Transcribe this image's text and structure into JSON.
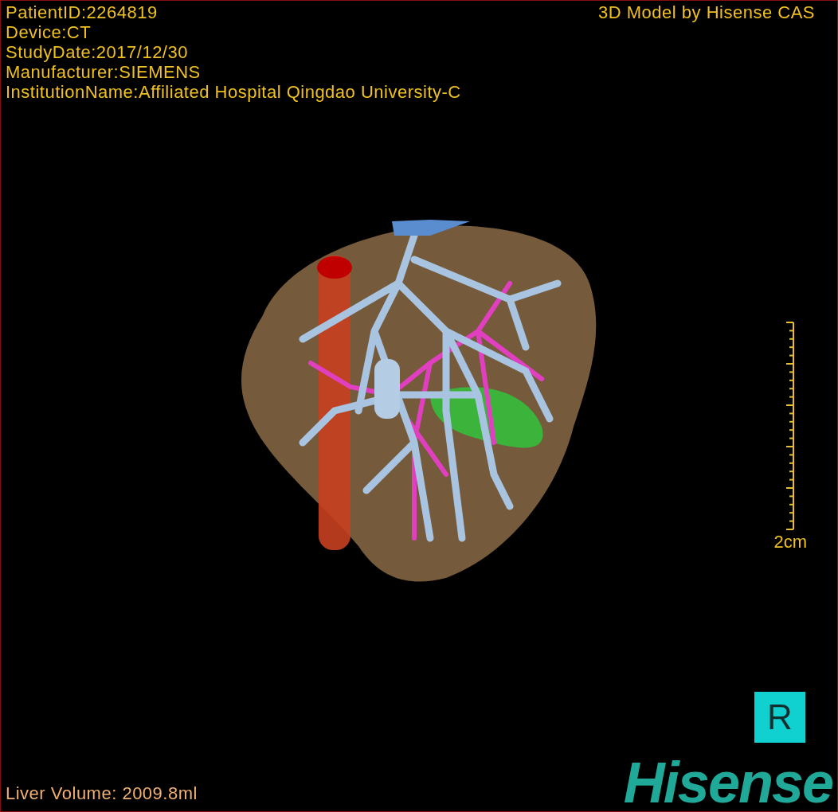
{
  "info_lines": [
    "PatientID:2264819",
    "Device:CT",
    "StudyDate:2017/12/30",
    "Manufacturer:SIEMENS",
    "InstitutionName:Affiliated Hospital Qingdao University-C"
  ],
  "title": "3D Model by Hisense CAS",
  "scale_bar": {
    "label": "2cm"
  },
  "orientation_marker": "R",
  "footer": {
    "liver_volume": "Liver Volume: 2009.8ml",
    "logo": "Hisense"
  }
}
